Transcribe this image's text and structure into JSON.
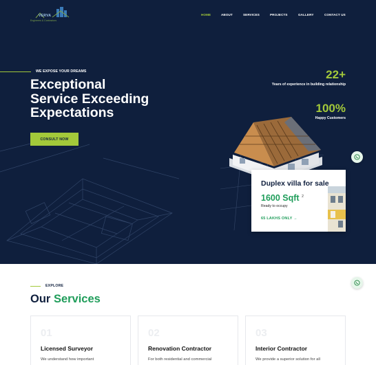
{
  "logo": {
    "name": "VERVA",
    "subtitle": "Engineers & Contractors"
  },
  "nav": {
    "items": [
      {
        "label": "HOME",
        "active": true
      },
      {
        "label": "ABOUT",
        "active": false
      },
      {
        "label": "SERVICES",
        "active": false
      },
      {
        "label": "PROJECTS",
        "active": false
      },
      {
        "label": "GALLERY",
        "active": false
      },
      {
        "label": "CONTACT US",
        "active": false
      }
    ]
  },
  "hero": {
    "tagline": "WE EXPOSE YOUR DREAMS",
    "headline": [
      "Exceptional",
      "Service Exceeding",
      "Expectations"
    ],
    "cta_label": "CONSULT NOW"
  },
  "stats": [
    {
      "value": "22+",
      "label": "Years of experience in building relationship"
    },
    {
      "value": "100%",
      "label": "Happy Customers"
    }
  ],
  "listing": {
    "title": "Duplex villa for sale",
    "area": "1600 Sqft",
    "area_sup": "2",
    "status": "Ready to occupy",
    "price": "65 LAKHS ONLY",
    "price_icon": "arrow-right-icon"
  },
  "services": {
    "eyebrow": "EXPLORE",
    "title_prefix": "Our",
    "title_accent": "Services",
    "items": [
      {
        "number": "01",
        "title": "Licensed Surveyor",
        "description": "We understand how important"
      },
      {
        "number": "02",
        "title": "Renovation Contractor",
        "description": "For both residential and commercial"
      },
      {
        "number": "03",
        "title": "Interior Contractor",
        "description": "We provide a superior solution for all"
      }
    ]
  },
  "colors": {
    "navy": "#0f1f3d",
    "lime": "#a3c93a",
    "green": "#1f9d5a"
  },
  "icons": {
    "whatsapp": "whatsapp-icon"
  }
}
